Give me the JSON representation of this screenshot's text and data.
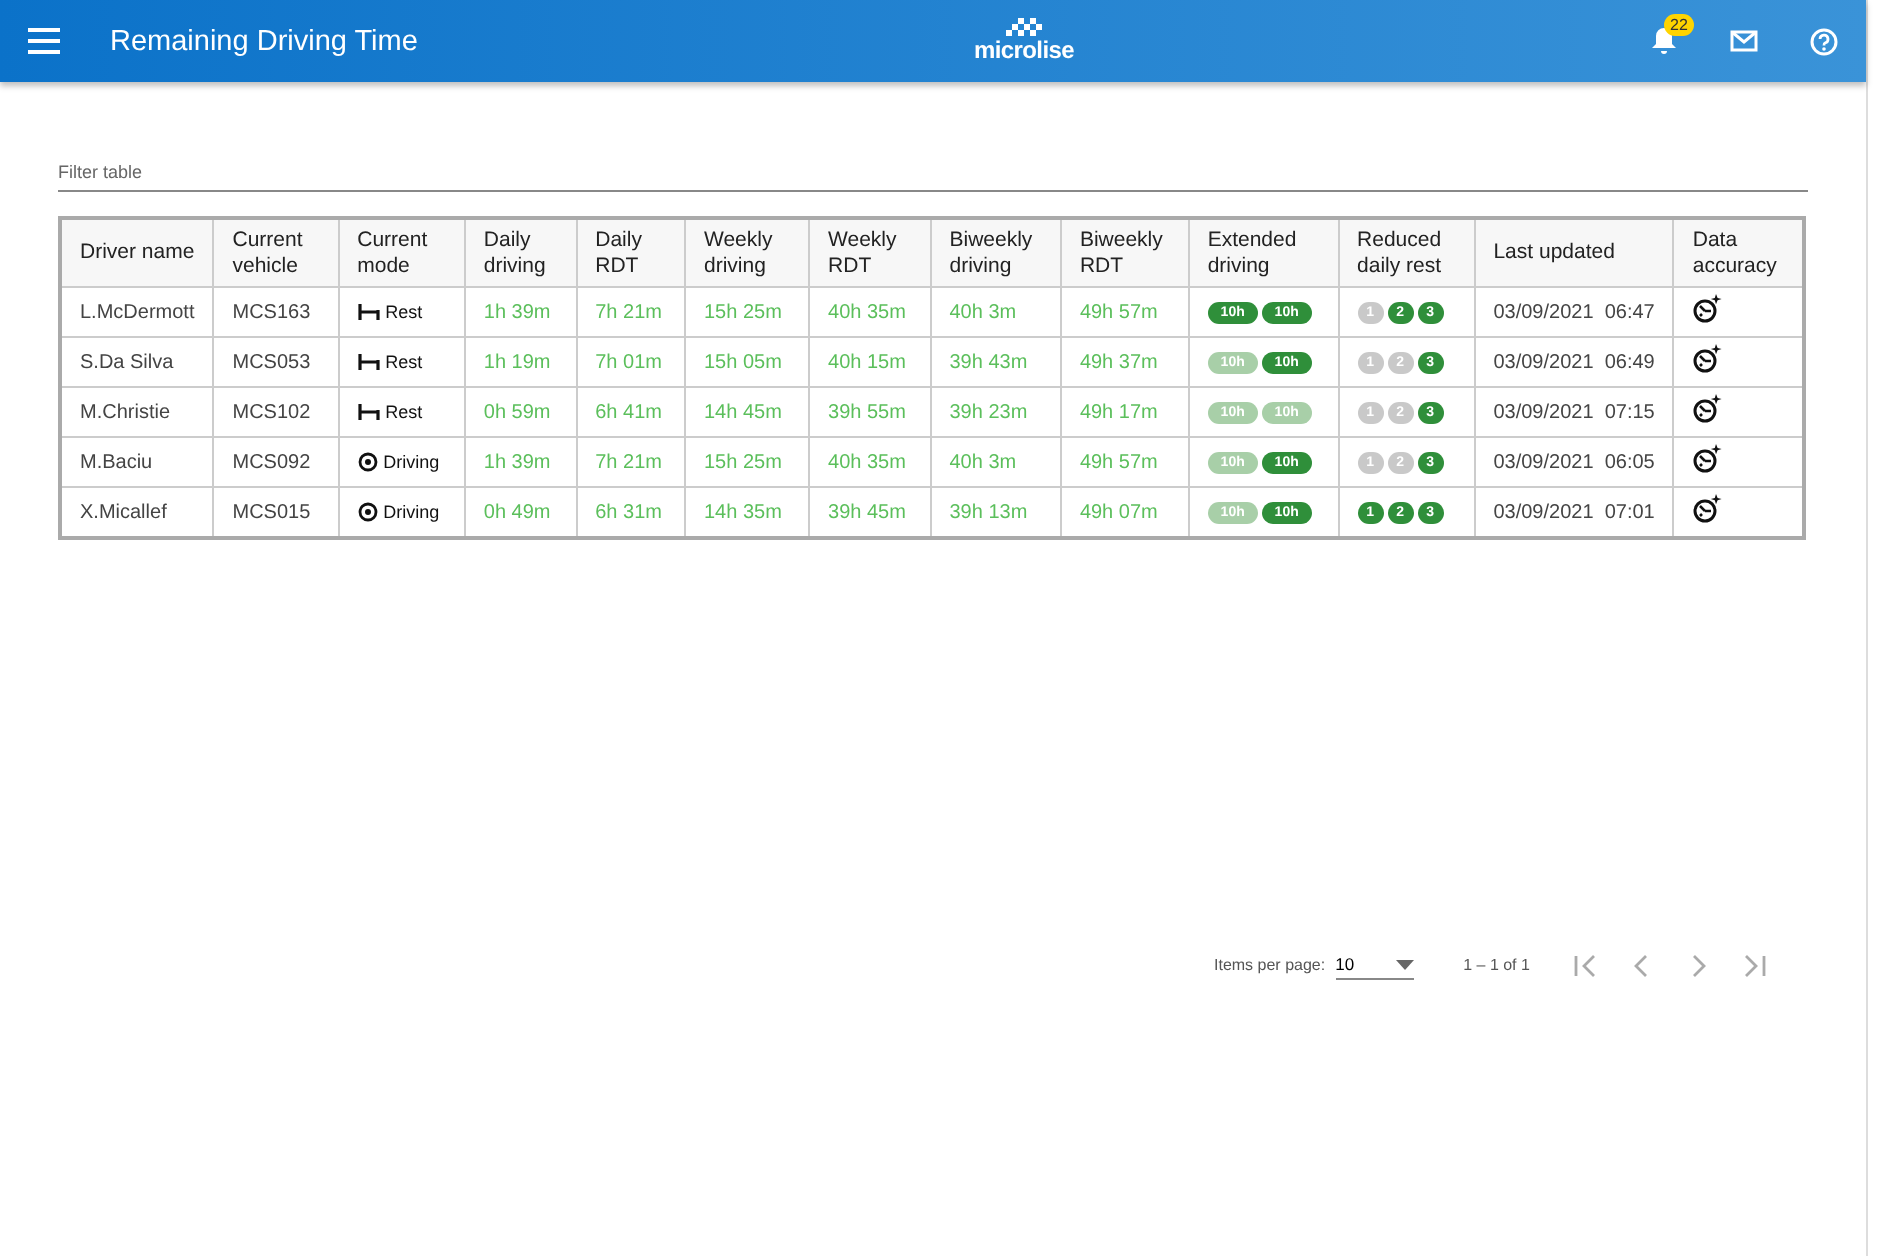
{
  "header": {
    "title": "Remaining Driving Time",
    "logo": "microlise",
    "notification_count": "22"
  },
  "filter": {
    "placeholder": "Filter table"
  },
  "table": {
    "columns": [
      "Driver name",
      "Current vehicle",
      "Current mode",
      "Daily driving",
      "Daily RDT",
      "Weekly driving",
      "Weekly RDT",
      "Biweekly driving",
      "Biweekly RDT",
      "Extended driving",
      "Reduced daily rest",
      "Last updated",
      "Data accuracy"
    ],
    "rows": [
      {
        "driver": "L.McDermott",
        "vehicle": "MCS163",
        "mode": {
          "kind": "rest",
          "label": "Rest"
        },
        "times": [
          "1h 39m",
          "7h 21m",
          "15h 25m",
          "40h 35m",
          "40h 3m",
          "49h 57m"
        ],
        "extended": [
          {
            "label": "10h",
            "on": true
          },
          {
            "label": "10h",
            "on": true
          }
        ],
        "reduced": [
          {
            "label": "1",
            "on": false
          },
          {
            "label": "2",
            "on": true
          },
          {
            "label": "3",
            "on": true
          }
        ],
        "updated": "03/09/2021  06:47"
      },
      {
        "driver": "S.Da Silva",
        "vehicle": "MCS053",
        "mode": {
          "kind": "rest",
          "label": "Rest"
        },
        "times": [
          "1h 19m",
          "7h 01m",
          "15h 05m",
          "40h 15m",
          "39h 43m",
          "49h 37m"
        ],
        "extended": [
          {
            "label": "10h",
            "on": false
          },
          {
            "label": "10h",
            "on": true
          }
        ],
        "reduced": [
          {
            "label": "1",
            "on": false
          },
          {
            "label": "2",
            "on": false
          },
          {
            "label": "3",
            "on": true
          }
        ],
        "updated": "03/09/2021  06:49"
      },
      {
        "driver": "M.Christie",
        "vehicle": "MCS102",
        "mode": {
          "kind": "rest",
          "label": "Rest"
        },
        "times": [
          "0h 59m",
          "6h 41m",
          "14h 45m",
          "39h 55m",
          "39h 23m",
          "49h 17m"
        ],
        "extended": [
          {
            "label": "10h",
            "on": false
          },
          {
            "label": "10h",
            "on": false
          }
        ],
        "reduced": [
          {
            "label": "1",
            "on": false
          },
          {
            "label": "2",
            "on": false
          },
          {
            "label": "3",
            "on": true
          }
        ],
        "updated": "03/09/2021  07:15"
      },
      {
        "driver": "M.Baciu",
        "vehicle": "MCS092",
        "mode": {
          "kind": "driving",
          "label": "Driving"
        },
        "times": [
          "1h 39m",
          "7h 21m",
          "15h 25m",
          "40h 35m",
          "40h 3m",
          "49h 57m"
        ],
        "extended": [
          {
            "label": "10h",
            "on": false
          },
          {
            "label": "10h",
            "on": true
          }
        ],
        "reduced": [
          {
            "label": "1",
            "on": false
          },
          {
            "label": "2",
            "on": false
          },
          {
            "label": "3",
            "on": true
          }
        ],
        "updated": "03/09/2021  06:05"
      },
      {
        "driver": "X.Micallef",
        "vehicle": "MCS015",
        "mode": {
          "kind": "driving",
          "label": "Driving"
        },
        "times": [
          "0h 49m",
          "6h 31m",
          "14h 35m",
          "39h 45m",
          "39h 13m",
          "49h 07m"
        ],
        "extended": [
          {
            "label": "10h",
            "on": false
          },
          {
            "label": "10h",
            "on": true
          }
        ],
        "reduced": [
          {
            "label": "1",
            "on": true
          },
          {
            "label": "2",
            "on": true
          },
          {
            "label": "3",
            "on": true
          }
        ],
        "updated": "03/09/2021  07:01"
      }
    ]
  },
  "paginator": {
    "label": "Items per page:",
    "page_size": "10",
    "range": "1 – 1 of 1"
  }
}
